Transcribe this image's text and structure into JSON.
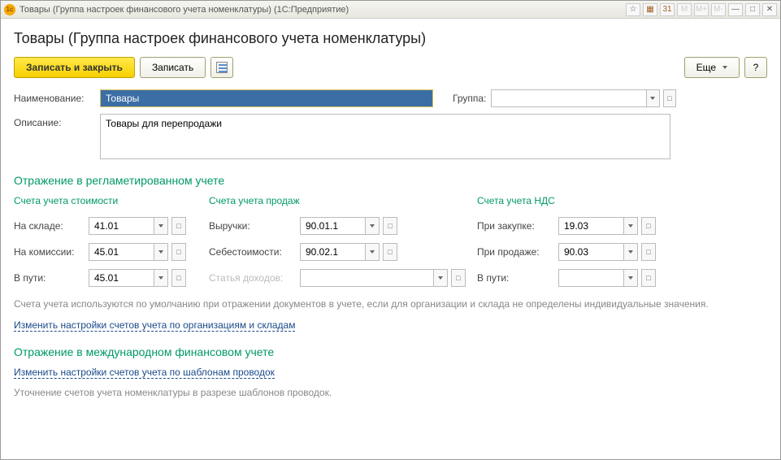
{
  "window": {
    "title": "Товары (Группа настроек финансового учета номенклатуры) (1С:Предприятие)"
  },
  "header": {
    "page_title": "Товары (Группа настроек финансового учета номенклатуры)"
  },
  "toolbar": {
    "save_close": "Записать и закрыть",
    "save": "Записать",
    "more": "Еще",
    "help": "?"
  },
  "fields": {
    "name_label": "Наименование:",
    "name_value": "Товары",
    "group_label": "Группа:",
    "group_value": "",
    "desc_label": "Описание:",
    "desc_value": "Товары для перепродажи"
  },
  "section_reg": {
    "title": "Отражение в регламетированном учете",
    "col_cost": "Счета учета стоимости",
    "col_sales": "Счета учета продаж",
    "col_vat": "Счета учета НДС",
    "rows": {
      "warehouse_label": "На складе:",
      "warehouse_value": "41.01",
      "commission_label": "На комиссии:",
      "commission_value": "45.01",
      "transit_label": "В пути:",
      "transit_value": "45.01",
      "revenue_label": "Выручки:",
      "revenue_value": "90.01.1",
      "cogs_label": "Себестоимости:",
      "cogs_value": "90.02.1",
      "income_item_label": "Статья доходов:",
      "income_item_value": "",
      "vat_purchase_label": "При закупке:",
      "vat_purchase_value": "19.03",
      "vat_sale_label": "При продаже:",
      "vat_sale_value": "90.03",
      "vat_transit_label": "В пути:",
      "vat_transit_value": ""
    },
    "note": "Счета учета используются по умолчанию при отражении документов в учете, если для организации и склада не определены индивидуальные значения.",
    "link": "Изменить настройки счетов учета по организациям и складам"
  },
  "section_intl": {
    "title": "Отражение в международном финансовом учете",
    "link": "Изменить настройки счетов учета по шаблонам проводок",
    "note": "Уточнение счетов учета номенклатуры в разрезе шаблонов проводок."
  }
}
